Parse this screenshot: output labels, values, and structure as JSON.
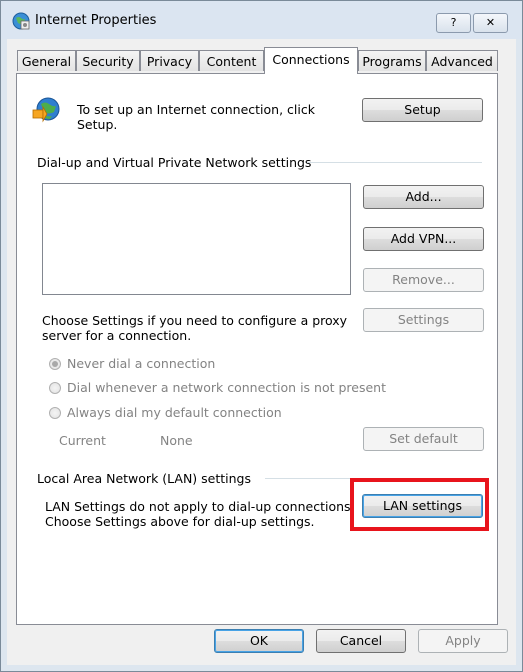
{
  "window": {
    "title": "Internet Properties",
    "help_label": "?",
    "close_label": "✕",
    "icon": "globe-gear-icon"
  },
  "tabs": [
    {
      "label": "General"
    },
    {
      "label": "Security"
    },
    {
      "label": "Privacy"
    },
    {
      "label": "Content"
    },
    {
      "label": "Connections",
      "selected": true
    },
    {
      "label": "Programs"
    },
    {
      "label": "Advanced"
    }
  ],
  "setup": {
    "text_line1": "To set up an Internet connection, click",
    "text_line2": "Setup.",
    "button": "Setup",
    "icon": "network-globe-icon"
  },
  "dialup": {
    "heading": "Dial-up and Virtual Private Network settings",
    "add_button": "Add...",
    "add_vpn_button": "Add VPN...",
    "remove_button": "Remove...",
    "proxy_text_line1": "Choose Settings if you need to configure a proxy",
    "proxy_text_line2": "server for a connection.",
    "settings_button": "Settings",
    "radio_never": "Never dial a connection",
    "radio_whenever": "Dial whenever a network connection is not present",
    "radio_always": "Always dial my default connection",
    "current_label": "Current",
    "current_value": "None",
    "set_default_button": "Set default"
  },
  "lan": {
    "heading": "Local Area Network (LAN) settings",
    "text_line1": "LAN Settings do not apply to dial-up connections.",
    "text_line2": "Choose Settings above for dial-up settings.",
    "button": "LAN settings",
    "highlight_color": "#e8141c"
  },
  "footer": {
    "ok": "OK",
    "cancel": "Cancel",
    "apply": "Apply"
  }
}
